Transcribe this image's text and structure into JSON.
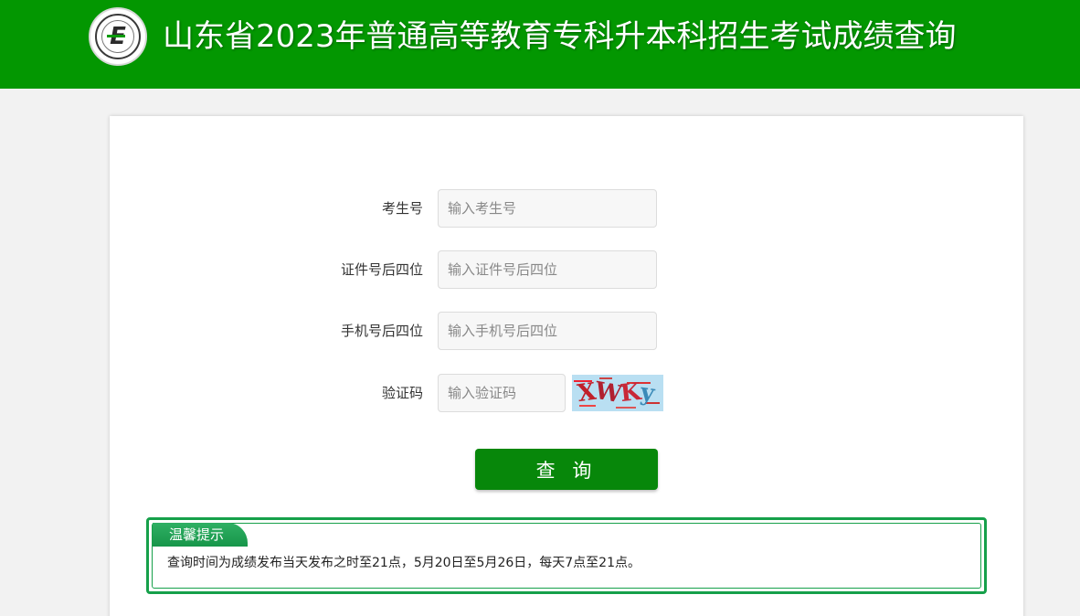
{
  "header": {
    "title": "山东省2023年普通高等教育专科升本科招生考试成绩查询",
    "logo_icon": "exam-authority-logo",
    "logo_letter": "E",
    "background": "#039701"
  },
  "form": {
    "fields": [
      {
        "label": "考生号",
        "placeholder": "输入考生号"
      },
      {
        "label": "证件号后四位",
        "placeholder": "输入证件号后四位"
      },
      {
        "label": "手机号后四位",
        "placeholder": "输入手机号后四位"
      },
      {
        "label": "验证码",
        "placeholder": "输入验证码"
      }
    ],
    "captcha_text": "XWKy2",
    "submit_label": "查 询",
    "button_color": "#07870a"
  },
  "tips": {
    "title": "温馨提示",
    "text": "查询时间为成绩发布当天发布之时至21点，5月20日至5月26日，每天7点至21点。",
    "border_color": "#16a04a"
  }
}
